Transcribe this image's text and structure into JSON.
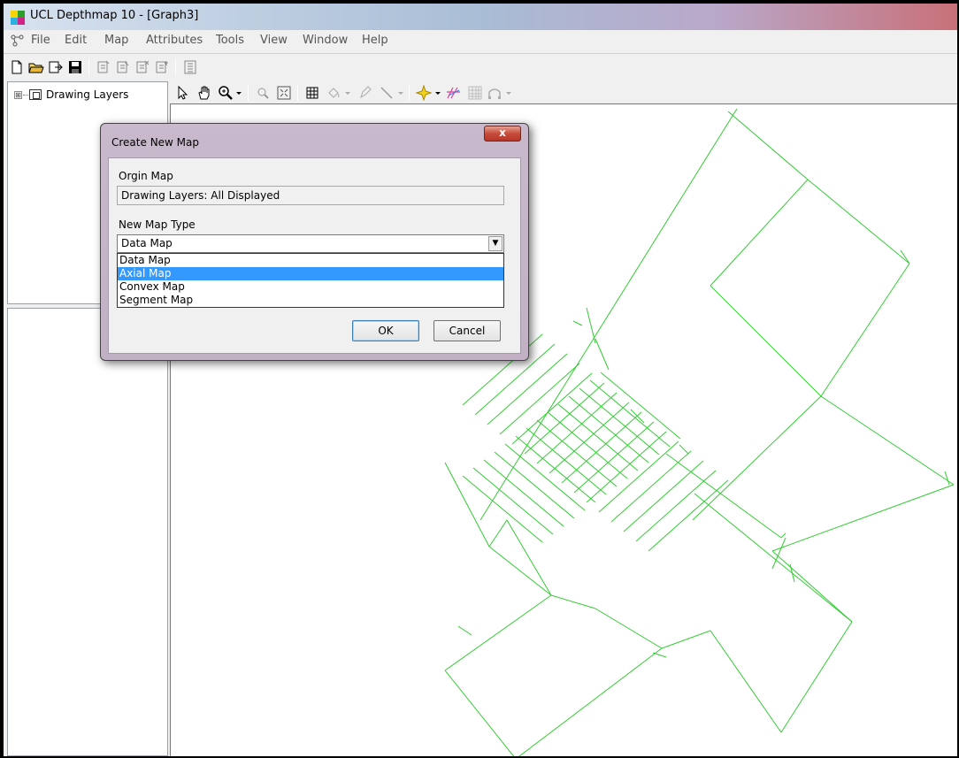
{
  "window": {
    "title": "UCL Depthmap 10 - [Graph3]"
  },
  "menubar": {
    "items": [
      "File",
      "Edit",
      "Map",
      "Attributes",
      "Tools",
      "View",
      "Window",
      "Help"
    ]
  },
  "tree": {
    "root_label": "Drawing Layers",
    "expand_glyph": "⊞"
  },
  "dialog": {
    "title": "Create New Map",
    "close_glyph": "x",
    "origin_label": "Orgin Map",
    "origin_value": "Drawing Layers: All Displayed",
    "type_label": "New Map Type",
    "type_selected": "Data Map",
    "type_options": [
      "Data Map",
      "Axial Map",
      "Convex Map",
      "Segment Map"
    ],
    "highlighted_option": "Axial Map",
    "ok_label": "OK",
    "cancel_label": "Cancel"
  },
  "colors": {
    "map_lines": "#33cc33",
    "selection": "#3399ff",
    "close_button": "#c74c3a"
  }
}
